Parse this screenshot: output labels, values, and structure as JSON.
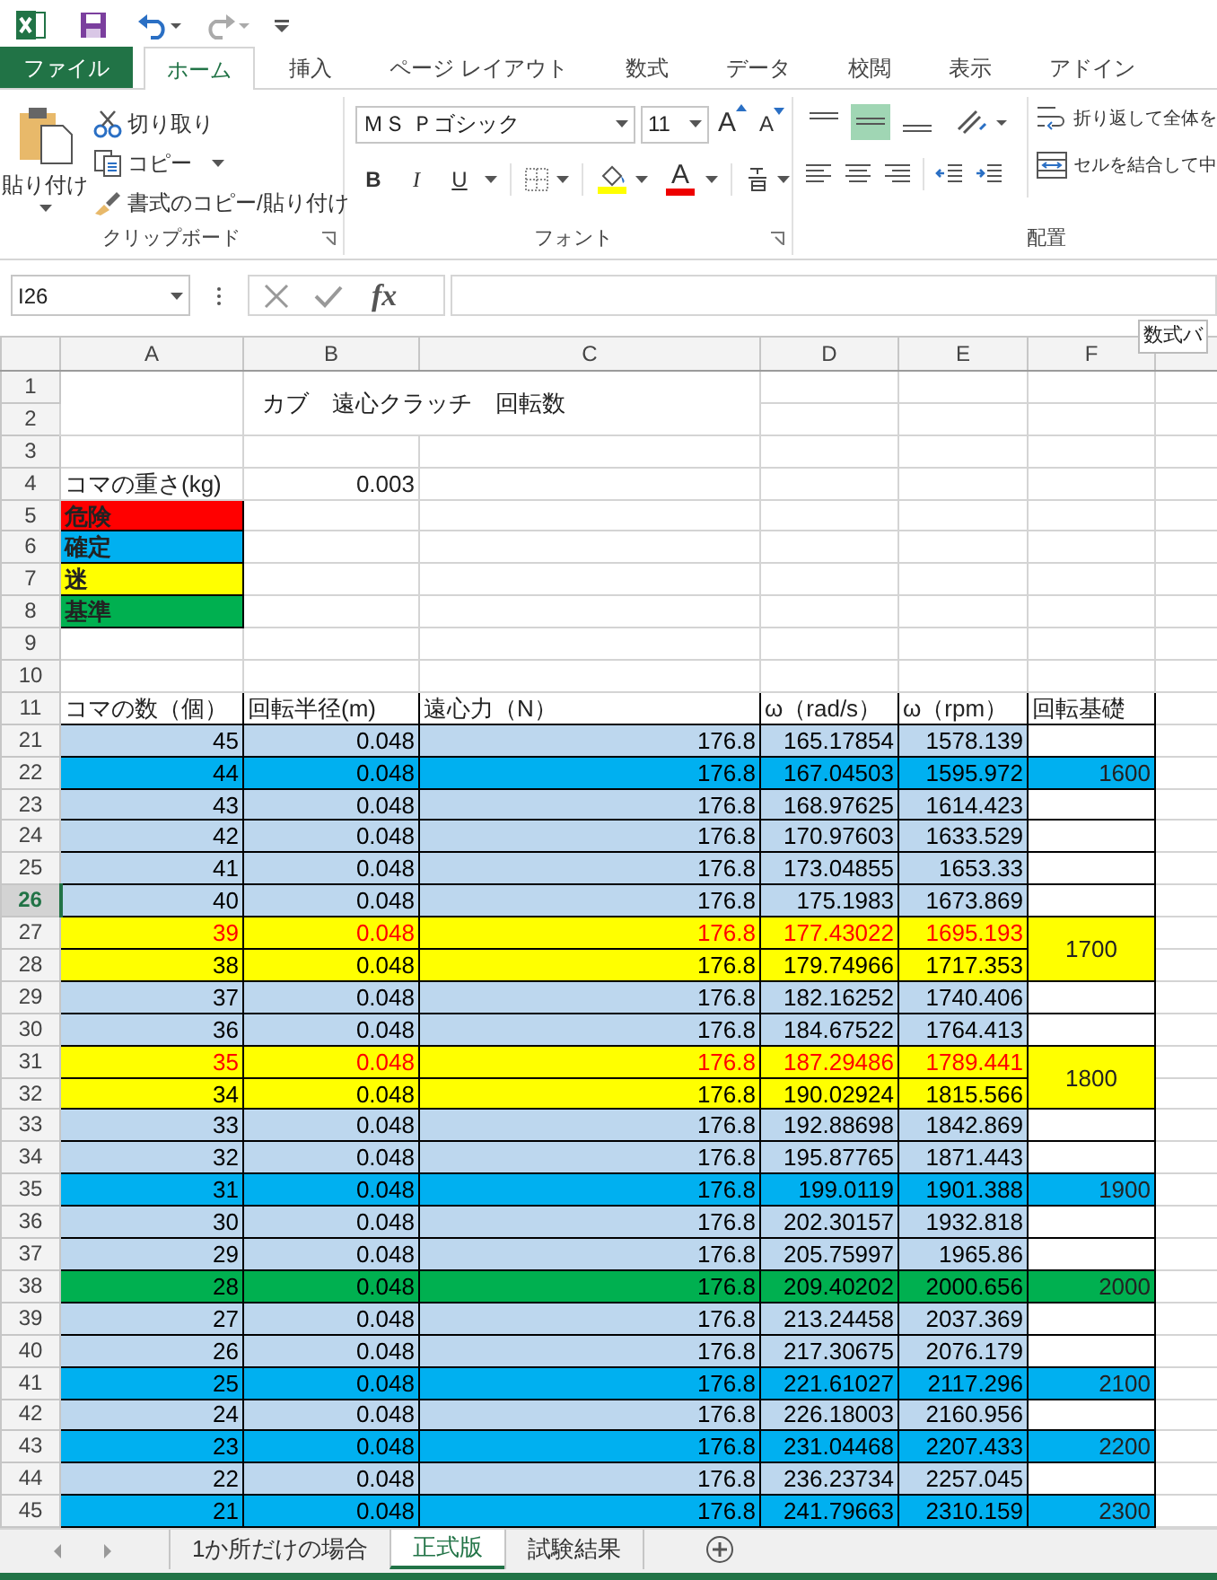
{
  "ribbon_tabs": [
    {
      "label": "ファイル",
      "kind": "file",
      "selected": false
    },
    {
      "label": "ホーム",
      "kind": "tab",
      "selected": true
    },
    {
      "label": "挿入",
      "kind": "tab",
      "selected": false
    },
    {
      "label": "ページ レイアウト",
      "kind": "tab",
      "selected": false
    },
    {
      "label": "数式",
      "kind": "tab",
      "selected": false
    },
    {
      "label": "データ",
      "kind": "tab",
      "selected": false
    },
    {
      "label": "校閲",
      "kind": "tab",
      "selected": false
    },
    {
      "label": "表示",
      "kind": "tab",
      "selected": false
    },
    {
      "label": "アドイン",
      "kind": "tab",
      "selected": false
    }
  ],
  "clipboard": {
    "paste": "貼り付け",
    "cut": "切り取り",
    "copy": "コピー",
    "format_painter": "書式のコピー/貼り付け",
    "group_label": "クリップボード"
  },
  "font": {
    "name": "ＭＳ Ｐゴシック",
    "size": "11",
    "grow": "A",
    "shrink": "A",
    "bold": "B",
    "italic": "I",
    "underline": "U",
    "font_color": "A",
    "group_label": "フォント"
  },
  "alignment": {
    "vertical": [
      {
        "selected": false
      },
      {
        "selected": true
      },
      {
        "selected": false
      }
    ],
    "wrap_text": "折り返して全体を",
    "merge": "セルを結合して中",
    "group_label": "配置"
  },
  "formula_bar": {
    "name_box": "I26",
    "fx": "fx",
    "tooltip": "数式バ"
  },
  "columns": [
    "A",
    "B",
    "C",
    "D",
    "E",
    "F"
  ],
  "sheet": {
    "top_row_numbers": [
      "1",
      "2",
      "3",
      "4",
      "5",
      "6",
      "7",
      "8",
      "9",
      "10"
    ],
    "title": "カブ　遠心クラッチ　回転数",
    "weight_label": "コマの重さ(kg)",
    "weight_value": "0.003",
    "legend": [
      {
        "label": "危険",
        "color": "#ff0000"
      },
      {
        "label": "確定",
        "color": "#00b0f0"
      },
      {
        "label": "迷",
        "color": "#ffff00"
      },
      {
        "label": "基準",
        "color": "#00b050"
      }
    ],
    "header": {
      "number": "11",
      "cells": [
        "コマの数（個）",
        "回転半径(m)",
        "遠心力（N）",
        "ω（rad/s）",
        "ω（rpm）",
        "回転基礎"
      ]
    },
    "rows": [
      {
        "number": "21",
        "selected": false,
        "color": "#bdd7ee",
        "red_text": false,
        "cells": [
          "45",
          "0.048",
          "176.8",
          "165.17854",
          "1578.139"
        ]
      },
      {
        "number": "22",
        "selected": false,
        "color": "#00b0f0",
        "red_text": false,
        "cells": [
          "44",
          "0.048",
          "176.8",
          "167.04503",
          "1595.972"
        ],
        "base": {
          "text": "1600",
          "color": "#00b0f0",
          "merged": false
        }
      },
      {
        "number": "23",
        "selected": false,
        "color": "#bdd7ee",
        "red_text": false,
        "cells": [
          "43",
          "0.048",
          "176.8",
          "168.97625",
          "1614.423"
        ]
      },
      {
        "number": "24",
        "selected": false,
        "color": "#bdd7ee",
        "red_text": false,
        "cells": [
          "42",
          "0.048",
          "176.8",
          "170.97603",
          "1633.529"
        ]
      },
      {
        "number": "25",
        "selected": false,
        "color": "#bdd7ee",
        "red_text": false,
        "cells": [
          "41",
          "0.048",
          "176.8",
          "173.04855",
          "1653.33"
        ]
      },
      {
        "number": "26",
        "selected": true,
        "color": "#bdd7ee",
        "red_text": false,
        "cells": [
          "40",
          "0.048",
          "176.8",
          "175.1983",
          "1673.869"
        ]
      },
      {
        "number": "27",
        "selected": false,
        "color": "#ffff00",
        "red_text": true,
        "cells": [
          "39",
          "0.048",
          "176.8",
          "177.43022",
          "1695.193"
        ],
        "base": {
          "text": "1700",
          "color": "#ffff00",
          "merged": true
        }
      },
      {
        "number": "28",
        "selected": false,
        "color": "#ffff00",
        "red_text": false,
        "cells": [
          "38",
          "0.048",
          "176.8",
          "179.74966",
          "1717.353"
        ]
      },
      {
        "number": "29",
        "selected": false,
        "color": "#bdd7ee",
        "red_text": false,
        "cells": [
          "37",
          "0.048",
          "176.8",
          "182.16252",
          "1740.406"
        ]
      },
      {
        "number": "30",
        "selected": false,
        "color": "#bdd7ee",
        "red_text": false,
        "cells": [
          "36",
          "0.048",
          "176.8",
          "184.67522",
          "1764.413"
        ]
      },
      {
        "number": "31",
        "selected": false,
        "color": "#ffff00",
        "red_text": true,
        "cells": [
          "35",
          "0.048",
          "176.8",
          "187.29486",
          "1789.441"
        ],
        "base": {
          "text": "1800",
          "color": "#ffff00",
          "merged": true
        }
      },
      {
        "number": "32",
        "selected": false,
        "color": "#ffff00",
        "red_text": false,
        "cells": [
          "34",
          "0.048",
          "176.8",
          "190.02924",
          "1815.566"
        ]
      },
      {
        "number": "33",
        "selected": false,
        "color": "#bdd7ee",
        "red_text": false,
        "cells": [
          "33",
          "0.048",
          "176.8",
          "192.88698",
          "1842.869"
        ]
      },
      {
        "number": "34",
        "selected": false,
        "color": "#bdd7ee",
        "red_text": false,
        "cells": [
          "32",
          "0.048",
          "176.8",
          "195.87765",
          "1871.443"
        ]
      },
      {
        "number": "35",
        "selected": false,
        "color": "#00b0f0",
        "red_text": false,
        "cells": [
          "31",
          "0.048",
          "176.8",
          "199.0119",
          "1901.388"
        ],
        "base": {
          "text": "1900",
          "color": "#00b0f0",
          "merged": false
        }
      },
      {
        "number": "36",
        "selected": false,
        "color": "#bdd7ee",
        "red_text": false,
        "cells": [
          "30",
          "0.048",
          "176.8",
          "202.30157",
          "1932.818"
        ]
      },
      {
        "number": "37",
        "selected": false,
        "color": "#bdd7ee",
        "red_text": false,
        "cells": [
          "29",
          "0.048",
          "176.8",
          "205.75997",
          "1965.86"
        ]
      },
      {
        "number": "38",
        "selected": false,
        "color": "#00b050",
        "red_text": false,
        "cells": [
          "28",
          "0.048",
          "176.8",
          "209.40202",
          "2000.656"
        ],
        "base": {
          "text": "2000",
          "color": "#00b050",
          "merged": false
        }
      },
      {
        "number": "39",
        "selected": false,
        "color": "#bdd7ee",
        "red_text": false,
        "cells": [
          "27",
          "0.048",
          "176.8",
          "213.24458",
          "2037.369"
        ]
      },
      {
        "number": "40",
        "selected": false,
        "color": "#bdd7ee",
        "red_text": false,
        "cells": [
          "26",
          "0.048",
          "176.8",
          "217.30675",
          "2076.179"
        ]
      },
      {
        "number": "41",
        "selected": false,
        "color": "#00b0f0",
        "red_text": false,
        "cells": [
          "25",
          "0.048",
          "176.8",
          "221.61027",
          "2117.296"
        ],
        "base": {
          "text": "2100",
          "color": "#00b0f0",
          "merged": false
        }
      },
      {
        "number": "42",
        "selected": false,
        "color": "#bdd7ee",
        "red_text": false,
        "cells": [
          "24",
          "0.048",
          "176.8",
          "226.18003",
          "2160.956"
        ]
      },
      {
        "number": "43",
        "selected": false,
        "color": "#00b0f0",
        "red_text": false,
        "cells": [
          "23",
          "0.048",
          "176.8",
          "231.04468",
          "2207.433"
        ],
        "base": {
          "text": "2200",
          "color": "#00b0f0",
          "merged": false
        }
      },
      {
        "number": "44",
        "selected": false,
        "color": "#bdd7ee",
        "red_text": false,
        "cells": [
          "22",
          "0.048",
          "176.8",
          "236.23734",
          "2257.045"
        ]
      },
      {
        "number": "45",
        "selected": false,
        "color": "#00b0f0",
        "red_text": false,
        "cells": [
          "21",
          "0.048",
          "176.8",
          "241.79663",
          "2310.159"
        ],
        "base": {
          "text": "2300",
          "color": "#00b0f0",
          "merged": false
        }
      }
    ]
  },
  "sheet_tabs": [
    {
      "label": "1か所だけの場合",
      "selected": false
    },
    {
      "label": "正式版",
      "selected": true
    },
    {
      "label": "試験結果",
      "selected": false
    }
  ]
}
